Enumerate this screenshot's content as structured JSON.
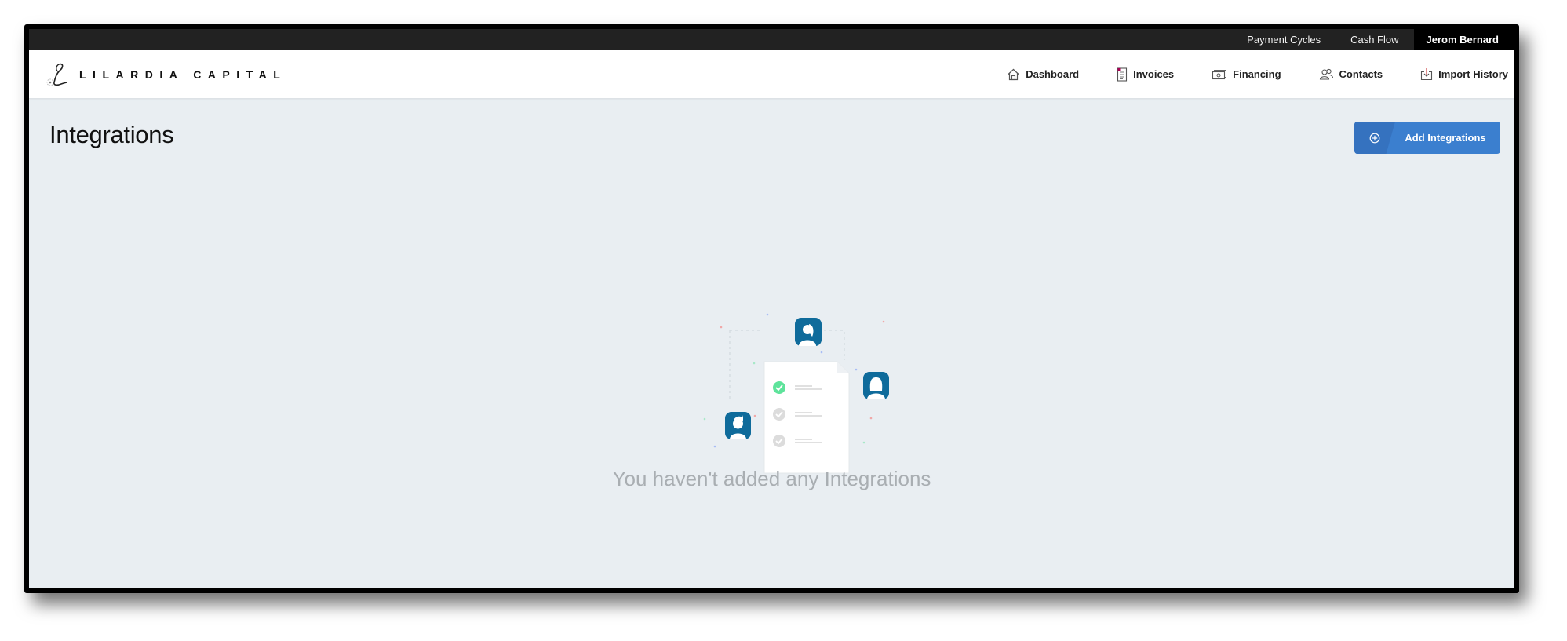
{
  "topbar": {
    "links": [
      {
        "label": "Payment Cycles"
      },
      {
        "label": "Cash Flow"
      }
    ],
    "user_name": "Jerom Bernard"
  },
  "brand": {
    "name": "LILARDIA CAPITAL",
    "icon": "script-l-logo"
  },
  "nav": {
    "items": [
      {
        "label": "Dashboard",
        "icon": "home-icon"
      },
      {
        "label": "Invoices",
        "icon": "document-icon"
      },
      {
        "label": "Financing",
        "icon": "banknote-icon"
      },
      {
        "label": "Contacts",
        "icon": "users-icon"
      },
      {
        "label": "Import History",
        "icon": "import-icon"
      }
    ]
  },
  "page": {
    "title": "Integrations",
    "add_button": {
      "label": "Add Integrations",
      "icon": "plus-circle-icon"
    },
    "empty_state": {
      "message": "You haven't added any Integrations",
      "illustration": "document-checklist-with-users"
    }
  },
  "colors": {
    "topbar_bg": "#222222",
    "user_bg": "#000000",
    "page_bg": "#e9eef2",
    "primary": "#3b7fcf",
    "avatar": "#0f6b9b",
    "check_active": "#5ee39b",
    "check_inactive": "#d6d6d6",
    "empty_text": "#a9aeb2"
  }
}
